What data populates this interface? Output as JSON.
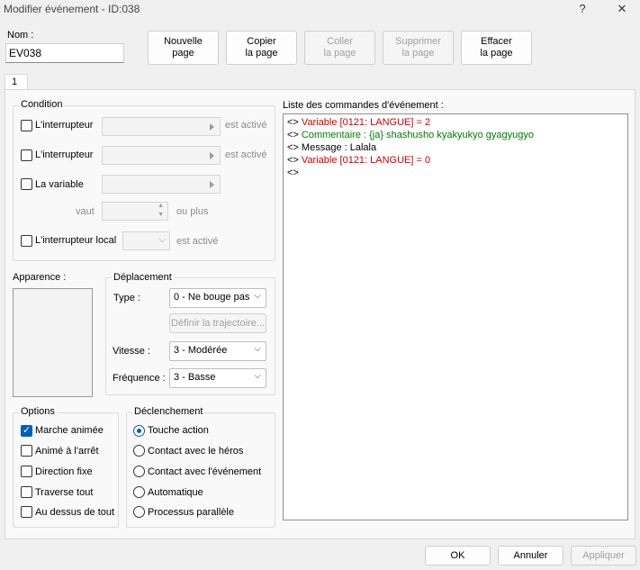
{
  "window": {
    "title": "Modifier événement - ID:038",
    "help_icon": "?",
    "close_icon": "✕"
  },
  "name": {
    "label": "Nom :",
    "value": "EV038"
  },
  "toolbar": {
    "new_page": [
      "Nouvelle",
      "page"
    ],
    "copy_page": [
      "Copier",
      "la page"
    ],
    "paste_page": [
      "Coller",
      "la page"
    ],
    "delete_page": [
      "Supprimer",
      "la page"
    ],
    "clear_page": [
      "Effacer",
      "la page"
    ]
  },
  "tabs": [
    "1"
  ],
  "condition": {
    "title": "Condition",
    "switch1": {
      "label": "L'interrupteur",
      "suffix": "est activé",
      "checked": false
    },
    "switch2": {
      "label": "L'interrupteur",
      "suffix": "est activé",
      "checked": false
    },
    "variable": {
      "label": "La variable",
      "checked": false,
      "vaut": "vaut",
      "ou_plus": "ou plus"
    },
    "local_switch": {
      "label": "L'interrupteur local",
      "suffix": "est activé",
      "checked": false
    }
  },
  "appearance": {
    "label": "Apparence :"
  },
  "movement": {
    "title": "Déplacement",
    "type_label": "Type :",
    "type_value": "0 - Ne bouge pas",
    "route_button": "Définir la trajectoire...",
    "speed_label": "Vitesse :",
    "speed_value": "3 - Modérée",
    "freq_label": "Fréquence :",
    "freq_value": "3 - Basse"
  },
  "options": {
    "title": "Options",
    "items": [
      {
        "label": "Marche animée",
        "checked": true
      },
      {
        "label": "Animé à l'arrêt",
        "checked": false
      },
      {
        "label": "Direction fixe",
        "checked": false
      },
      {
        "label": "Traverse tout",
        "checked": false
      },
      {
        "label": "Au dessus de tout",
        "checked": false
      }
    ]
  },
  "trigger": {
    "title": "Déclenchement",
    "items": [
      {
        "label": "Touche action",
        "checked": true
      },
      {
        "label": "Contact avec le héros",
        "checked": false
      },
      {
        "label": "Contact avec l'événement",
        "checked": false
      },
      {
        "label": "Automatique",
        "checked": false
      },
      {
        "label": "Processus parallèle",
        "checked": false
      }
    ]
  },
  "commands": {
    "label": "Liste des commandes d'événement :",
    "lines": [
      {
        "prefix": "<>",
        "text": "Variable [0121: LANGUE] = 2",
        "color": "#d40000"
      },
      {
        "prefix": "<>",
        "text": "Commentaire : {ja} shashusho kyakyukyo gyagyugyo",
        "color": "#007a00"
      },
      {
        "prefix": "<>",
        "text": "Message : Lalala",
        "color": "#000000"
      },
      {
        "prefix": "<>",
        "text": "Variable [0121: LANGUE] = 0",
        "color": "#d40000"
      },
      {
        "prefix": "<>",
        "text": "",
        "color": "#000000"
      }
    ]
  },
  "footer": {
    "ok": "OK",
    "cancel": "Annuler",
    "apply": "Appliquer"
  }
}
